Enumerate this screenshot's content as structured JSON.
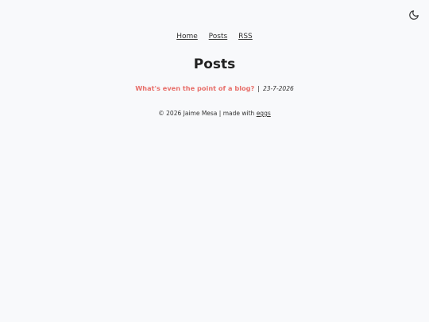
{
  "header": {
    "theme_toggle_icon": "moon-icon"
  },
  "nav": {
    "items": [
      {
        "label": "Home"
      },
      {
        "label": "Posts"
      },
      {
        "label": "RSS"
      }
    ]
  },
  "page": {
    "title": "Posts"
  },
  "posts": [
    {
      "title": "What's even the point of a blog?",
      "separator": "|",
      "date": "23-7-2026"
    }
  ],
  "footer": {
    "copyright": "© 2026 Jaime Mesa",
    "separator": "|",
    "made_with": "made with",
    "link_label": "eggs"
  },
  "colors": {
    "background": "#f8f9fb",
    "accent": "#e8706b",
    "text": "#2b2b2b"
  }
}
